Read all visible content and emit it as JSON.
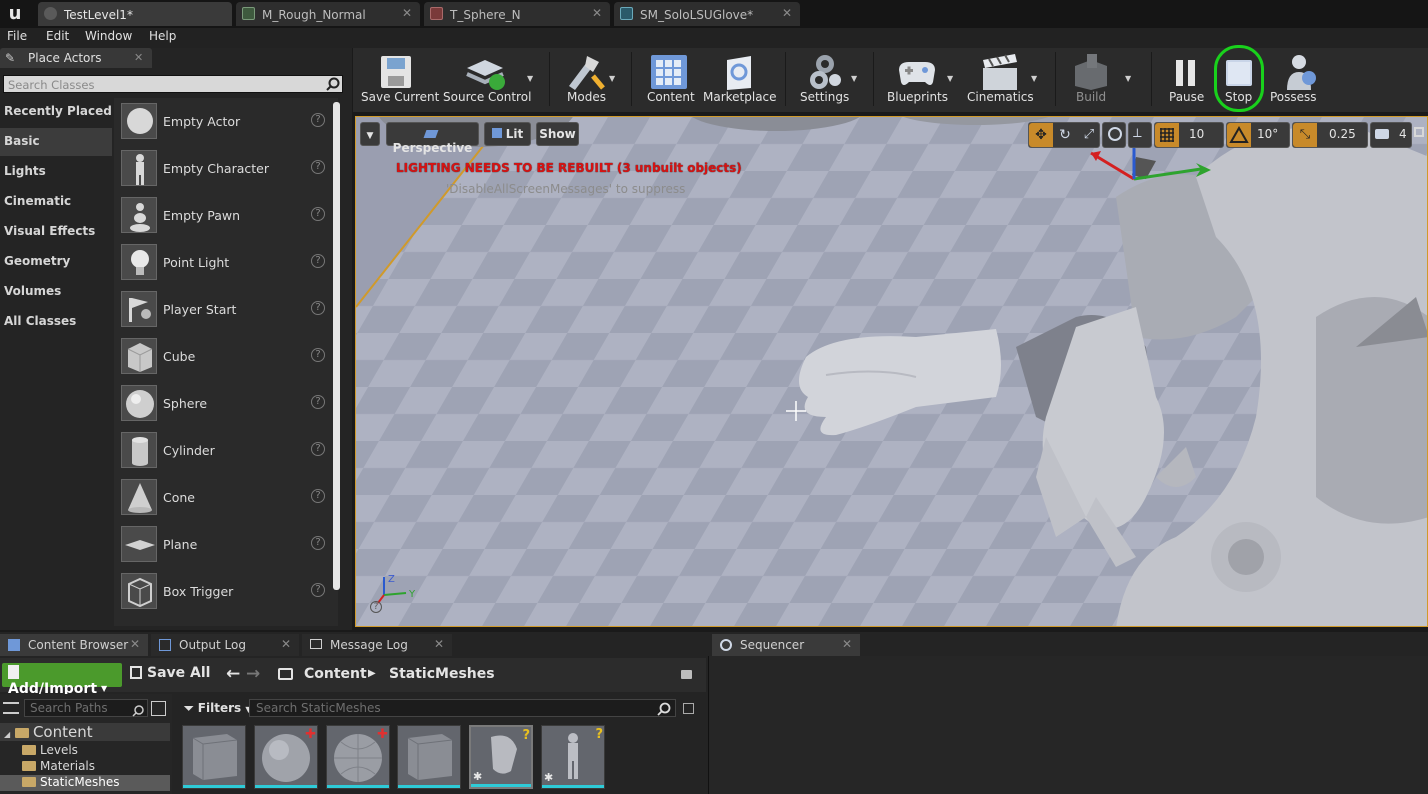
{
  "document_tabs": [
    {
      "label": "TestLevel1*",
      "icon": "ue-level-icon"
    },
    {
      "label": "M_Rough_Normal",
      "icon": "material-icon"
    },
    {
      "label": "T_Sphere_N",
      "icon": "texture-icon"
    },
    {
      "label": "SM_SoloLSUGlove*",
      "icon": "static-mesh-icon"
    }
  ],
  "menu": [
    "File",
    "Edit",
    "Window",
    "Help"
  ],
  "place_actors": {
    "tab_label": "Place Actors",
    "search_placeholder": "Search Classes",
    "categories": [
      "Recently Placed",
      "Basic",
      "Lights",
      "Cinematic",
      "Visual Effects",
      "Geometry",
      "Volumes",
      "All Classes"
    ],
    "selected_category": "Basic",
    "items": [
      "Empty Actor",
      "Empty Character",
      "Empty Pawn",
      "Point Light",
      "Player Start",
      "Cube",
      "Sphere",
      "Cylinder",
      "Cone",
      "Plane",
      "Box Trigger"
    ]
  },
  "toolbar": {
    "buttons": [
      "Save Current",
      "Source Control",
      "Modes",
      "Content",
      "Marketplace",
      "Settings",
      "Blueprints",
      "Cinematics",
      "Build",
      "Pause",
      "Stop",
      "Possess"
    ],
    "highlight_color": "#19d11c"
  },
  "viewport": {
    "options_label": "",
    "perspective_label": "Perspective",
    "lit_label": "Lit",
    "show_label": "Show",
    "grid_snap": "10",
    "rotation_snap": "10°",
    "scale_snap": "0.25",
    "camera_speed": "4",
    "lighting_warning": "LIGHTING NEEDS TO BE REBUILT (3 unbuilt objects)",
    "suppress_message": "'DisableAllScreenMessages' to suppress",
    "border_color": "#d09a2a"
  },
  "bottom_tabs": [
    "Content Browser",
    "Output Log",
    "Message Log",
    "Sequencer"
  ],
  "content_browser": {
    "add_import_label": "Add/Import",
    "save_all_label": "Save All",
    "breadcrumb": [
      "Content",
      "StaticMeshes"
    ],
    "search_paths_placeholder": "Search Paths",
    "filters_label": "Filters",
    "search_assets_placeholder": "Search StaticMeshes",
    "tree": [
      {
        "label": "Content",
        "level": 0
      },
      {
        "label": "Levels",
        "level": 1
      },
      {
        "label": "Materials",
        "level": 1
      },
      {
        "label": "StaticMeshes",
        "level": 1
      }
    ],
    "asset_count": 6
  }
}
